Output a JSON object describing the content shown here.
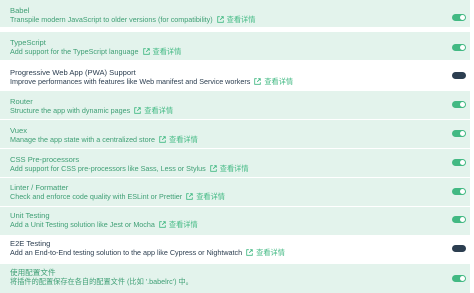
{
  "features": [
    {
      "title": "Babel",
      "desc": "Transpile modern JavaScript to older versions (for compatibility)",
      "link": "查看详情",
      "enabled": true
    },
    {
      "title": "TypeScript",
      "desc": "Add support for the TypeScript language",
      "link": "查看详情",
      "enabled": true
    },
    {
      "title": "Progressive Web App (PWA) Support",
      "desc": "Improve performances with features like Web manifest and Service workers",
      "link": "查看详情",
      "enabled": false
    },
    {
      "title": "Router",
      "desc": "Structure the app with dynamic pages",
      "link": "查看详情",
      "enabled": true
    },
    {
      "title": "Vuex",
      "desc": "Manage the app state with a centralized store",
      "link": "查看详情",
      "enabled": true
    },
    {
      "title": "CSS Pre-processors",
      "desc": "Add support for CSS pre-processors like Sass, Less or Stylus",
      "link": "查看详情",
      "enabled": true
    },
    {
      "title": "Linter / Formatter",
      "desc": "Check and enforce code quality with ESLint or Prettier",
      "link": "查看详情",
      "enabled": true
    },
    {
      "title": "Unit Testing",
      "desc": "Add a Unit Testing solution like Jest or Mocha",
      "link": "查看详情",
      "enabled": true
    },
    {
      "title": "E2E Testing",
      "desc": "Add an End-to-End testing solution to the app like Cypress or Nightwatch",
      "link": "查看详情",
      "enabled": false
    },
    {
      "title": "使用配置文件",
      "desc": "将插件的配置保存在各自的配置文件 (比如 '.babelrc') 中。",
      "link": "",
      "enabled": true
    }
  ],
  "colors": {
    "accent": "#42b983",
    "selected_bg": "#e3f3ec",
    "dark": "#2c3e50"
  }
}
